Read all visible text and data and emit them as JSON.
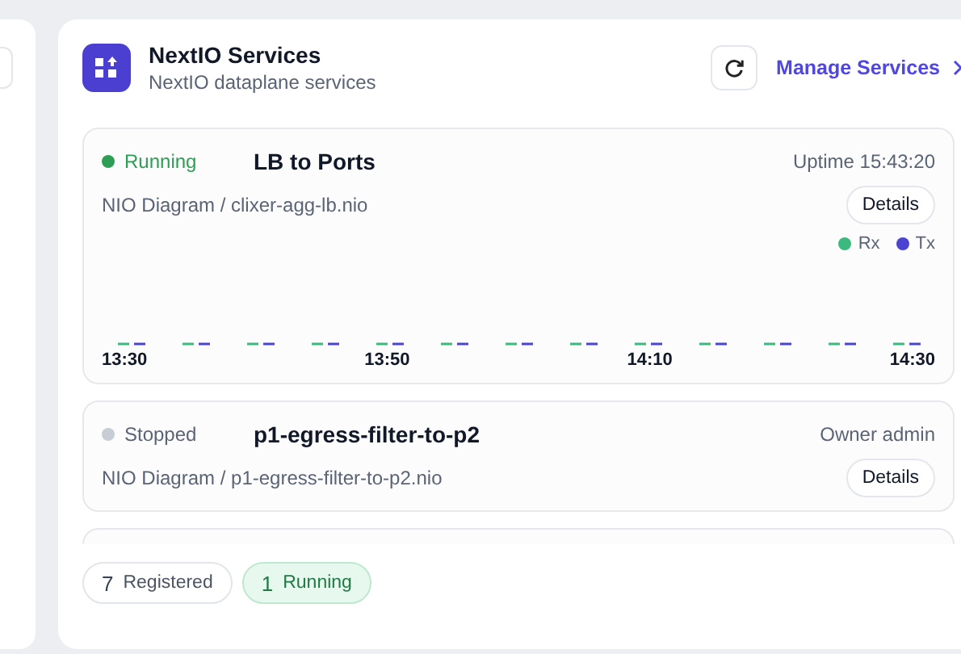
{
  "header": {
    "title": "NextIO Services",
    "subtitle": "NextIO dataplane services",
    "manage_link": "Manage Services"
  },
  "services": [
    {
      "running": true,
      "status_label": "Running",
      "name": "LB to Ports",
      "meta": "Uptime 15:43:20",
      "path": "NIO Diagram / clixer-agg-lb.nio",
      "details": "Details",
      "traffic": {
        "legend": [
          {
            "name": "Rx",
            "color": "#3cb97f"
          },
          {
            "name": "Tx",
            "color": "#4a44d0"
          }
        ],
        "time_labels": [
          "13:30",
          "13:50",
          "14:10",
          "14:30"
        ]
      }
    },
    {
      "running": false,
      "status_label": "Stopped",
      "name": "p1-egress-filter-to-p2",
      "meta": "Owner admin",
      "path": "NIO Diagram / p1-egress-filter-to-p2.nio",
      "details": "Details"
    }
  ],
  "summary": [
    {
      "kind": "total",
      "count": "7",
      "label": "Registered"
    },
    {
      "kind": "running",
      "count": "1",
      "label": "Running"
    }
  ]
}
